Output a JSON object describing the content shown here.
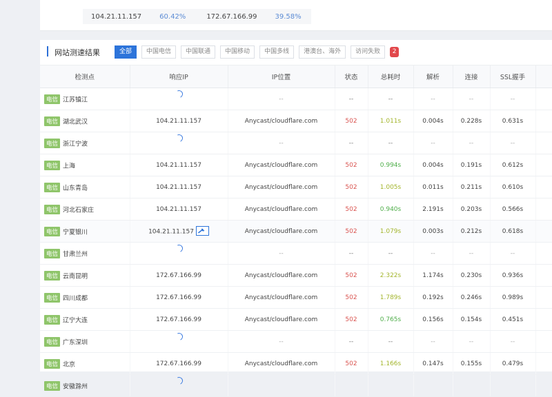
{
  "summary": [
    {
      "ip": "104.21.11.157",
      "pct": "60.42%"
    },
    {
      "ip": "172.67.166.99",
      "pct": "39.58%"
    }
  ],
  "panel": {
    "title": "网站测速结果",
    "filters": [
      "全部",
      "中国电信",
      "中国联通",
      "中国移动",
      "中国多线",
      "港澳台、海外",
      "访问失败"
    ],
    "fail_count": "2"
  },
  "columns": [
    "检测点",
    "响应IP",
    "IP位置",
    "状态",
    "总耗时",
    "解析",
    "连接",
    "SSL握手"
  ],
  "rows": [
    {
      "isp": "电信",
      "city": "江苏镇江",
      "ip": "",
      "loc": "--",
      "status": "--",
      "total": "--",
      "dns": "--",
      "conn": "--",
      "ssl": "--",
      "loading": true
    },
    {
      "isp": "电信",
      "city": "湖北武汉",
      "ip": "104.21.11.157",
      "loc": "Anycast/cloudflare.com",
      "status": "502",
      "total": "1.011s",
      "dns": "0.004s",
      "conn": "0.228s",
      "ssl": "0.631s",
      "loading": false
    },
    {
      "isp": "电信",
      "city": "浙江宁波",
      "ip": "",
      "loc": "--",
      "status": "--",
      "total": "--",
      "dns": "--",
      "conn": "--",
      "ssl": "--",
      "loading": true
    },
    {
      "isp": "电信",
      "city": "上海",
      "ip": "104.21.11.157",
      "loc": "Anycast/cloudflare.com",
      "status": "502",
      "total": "0.994s",
      "dns": "0.004s",
      "conn": "0.191s",
      "ssl": "0.612s",
      "loading": false
    },
    {
      "isp": "电信",
      "city": "山东青岛",
      "ip": "104.21.11.157",
      "loc": "Anycast/cloudflare.com",
      "status": "502",
      "total": "1.005s",
      "dns": "0.011s",
      "conn": "0.211s",
      "ssl": "0.610s",
      "loading": false
    },
    {
      "isp": "电信",
      "city": "河北石家庄",
      "ip": "104.21.11.157",
      "loc": "Anycast/cloudflare.com",
      "status": "502",
      "total": "0.940s",
      "dns": "2.191s",
      "conn": "0.203s",
      "ssl": "0.566s",
      "loading": false
    },
    {
      "isp": "电信",
      "city": "宁夏银川",
      "ip": "104.21.11.157",
      "loc": "Anycast/cloudflare.com",
      "status": "502",
      "total": "1.079s",
      "dns": "0.003s",
      "conn": "0.212s",
      "ssl": "0.618s",
      "loading": false,
      "wrench": true
    },
    {
      "isp": "电信",
      "city": "甘肃兰州",
      "ip": "",
      "loc": "--",
      "status": "--",
      "total": "--",
      "dns": "--",
      "conn": "--",
      "ssl": "--",
      "loading": true
    },
    {
      "isp": "电信",
      "city": "云南昆明",
      "ip": "172.67.166.99",
      "loc": "Anycast/cloudflare.com",
      "status": "502",
      "total": "2.322s",
      "dns": "1.174s",
      "conn": "0.230s",
      "ssl": "0.936s",
      "loading": false
    },
    {
      "isp": "电信",
      "city": "四川成都",
      "ip": "172.67.166.99",
      "loc": "Anycast/cloudflare.com",
      "status": "502",
      "total": "1.789s",
      "dns": "0.192s",
      "conn": "0.246s",
      "ssl": "0.989s",
      "loading": false
    },
    {
      "isp": "电信",
      "city": "辽宁大连",
      "ip": "172.67.166.99",
      "loc": "Anycast/cloudflare.com",
      "status": "502",
      "total": "0.765s",
      "dns": "0.156s",
      "conn": "0.154s",
      "ssl": "0.451s",
      "loading": false
    },
    {
      "isp": "电信",
      "city": "广东深圳",
      "ip": "",
      "loc": "--",
      "status": "--",
      "total": "--",
      "dns": "--",
      "conn": "--",
      "ssl": "--",
      "loading": true
    },
    {
      "isp": "电信",
      "city": "北京",
      "ip": "172.67.166.99",
      "loc": "Anycast/cloudflare.com",
      "status": "502",
      "total": "1.166s",
      "dns": "0.147s",
      "conn": "0.155s",
      "ssl": "0.479s",
      "loading": false
    },
    {
      "isp": "电信",
      "city": "安徽滁州",
      "ip": "",
      "loc": "",
      "status": "",
      "total": "",
      "dns": "",
      "conn": "",
      "ssl": "",
      "loading": true
    }
  ],
  "colors": {
    "accent": "#2d74da",
    "isp_badge": "#8fc56a",
    "status_error": "#d9534f",
    "fast": "#4fae4a",
    "medium": "#a3b52c",
    "badge": "#e2474b"
  }
}
